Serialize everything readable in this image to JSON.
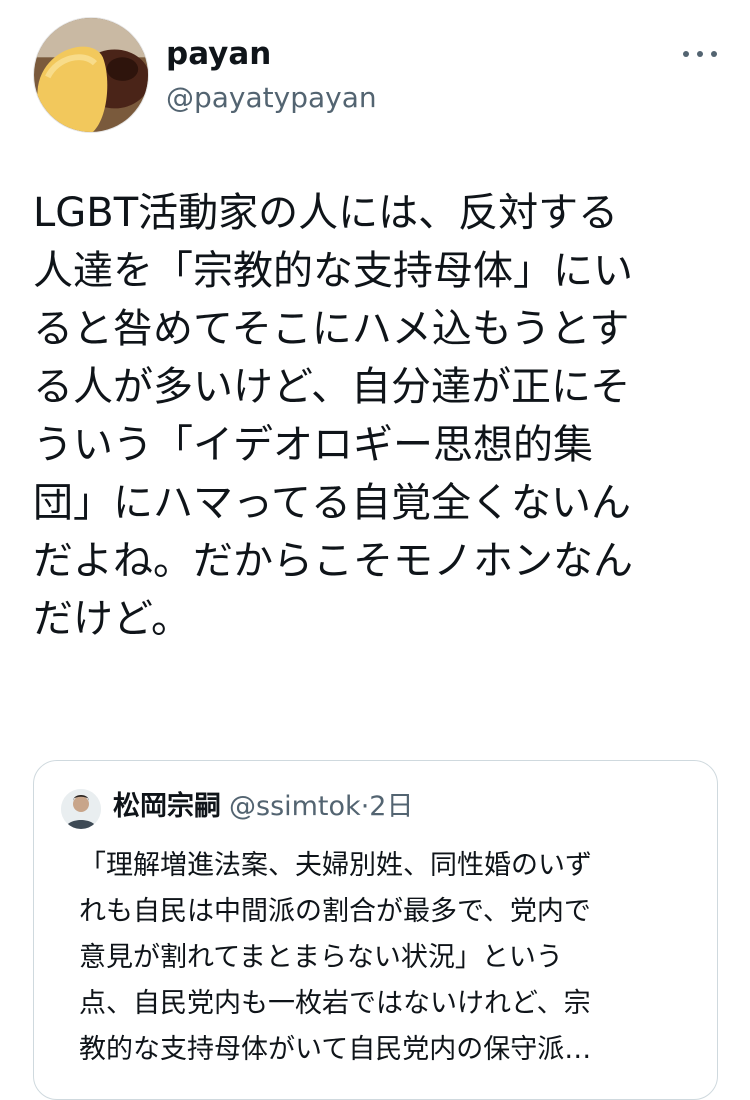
{
  "author": {
    "name": "payan",
    "handle": "@payatypayan"
  },
  "icons": {
    "more": "more-horizontal-icon",
    "avatar": "omelette-photo-avatar"
  },
  "tweet": {
    "lines": [
      "LGBT活動家の人には、反対する",
      "人達を「宗教的な支持母体」にい",
      "ると咎めてそこにハメ込もうとす",
      "る人が多いけど、自分達が正にそ",
      "ういう「イデオロギー思想的集",
      "団」にハマってる自覚全くないん",
      "だよね。だからこそモノホンなん",
      "だけど。"
    ]
  },
  "quote": {
    "name": "松岡宗嗣",
    "handle": "@ssimtok",
    "separator": "·",
    "time": "2日",
    "lines": [
      "「理解増進法案、夫婦別姓、同性婚のいず",
      "れも自民は中間派の割合が最多で、党内で",
      "意見が割れてまとまらない状況」という",
      "点、自民党内も一枚岩ではないけれど、宗",
      "教的な支持母体がいて自民党内の保守派…"
    ]
  },
  "colors": {
    "text_primary": "#0f1419",
    "text_secondary": "#536471",
    "border": "#cfd9de",
    "background": "#ffffff"
  }
}
